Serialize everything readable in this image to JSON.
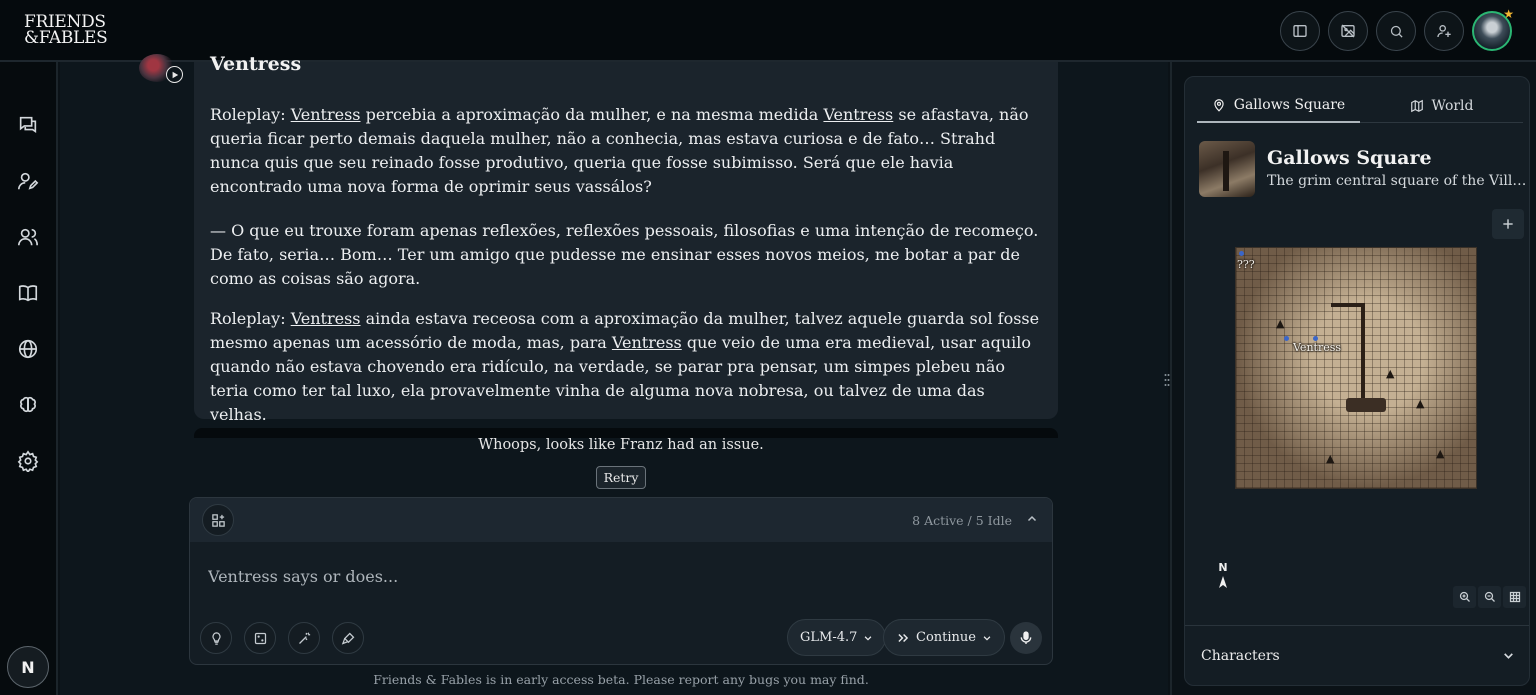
{
  "brand": {
    "line1": "FRIENDS",
    "line2": "&FABLES"
  },
  "topbar": {
    "buttons": [
      "sidebar-toggle-icon",
      "image-off-icon",
      "search-icon",
      "add-user-icon"
    ],
    "avatar_badge": "★"
  },
  "leftnav": {
    "items": [
      "chat-icon",
      "character-edit-icon",
      "party-icon",
      "book-icon",
      "globe-icon",
      "brain-icon",
      "settings-icon"
    ],
    "user_initial": "N"
  },
  "message": {
    "author": "Ventress",
    "paragraphs": [
      [
        {
          "t": "Roleplay: "
        },
        {
          "t": "Ventress",
          "u": true
        },
        {
          "t": " percebia a aproximação da mulher, e na mesma medida "
        },
        {
          "t": "Ventress",
          "u": true
        },
        {
          "t": " se afastava, não queria ficar perto demais daquela mulher, não a conhecia, mas estava curiosa e de fato… Strahd nunca quis que seu reinado fosse produtivo, queria que fosse subimisso. Será que ele havia encontrado uma nova forma de oprimir seus vassálos?"
        }
      ],
      [
        {
          "t": "— O que eu trouxe foram apenas reflexões, reflexões pessoais, filosofias e uma intenção de recomeço. De fato, seria… Bom… Ter um amigo que pudesse me ensinar esses novos meios, me botar a par de como as coisas são agora."
        }
      ],
      [
        {
          "t": "Roleplay: "
        },
        {
          "t": "Ventress",
          "u": true
        },
        {
          "t": " ainda estava receosa com a aproximação da mulher, talvez aquele guarda sol fosse mesmo apenas um acessório de moda, mas, para "
        },
        {
          "t": "Ventress",
          "u": true
        },
        {
          "t": " que veio de uma era medieval, usar aquilo quando não estava chovendo era ridículo, na verdade, se parar pra pensar, um simpes plebeu não teria como ter tal luxo, ela provavelmente vinha de alguma nova nobresa, ou talvez de uma das velhas."
        }
      ]
    ]
  },
  "error": {
    "text": "Whoops, looks like Franz had an issue.",
    "retry_label": "Retry"
  },
  "composer": {
    "status": "8 Active / 5 Idle",
    "placeholder": "Ventress says or does...",
    "model": "GLM-4.7",
    "continue_label": "Continue"
  },
  "footer": "Friends & Fables is in early access beta. Please report any bugs you may find.",
  "panel": {
    "tabs": [
      {
        "label": "Gallows Square",
        "icon": "map-pin-icon",
        "active": true
      },
      {
        "label": "World",
        "icon": "map-icon",
        "active": false
      }
    ],
    "location_title": "Gallows Square",
    "location_desc": "The grim central square of the Village of Barovia.",
    "map_labels": {
      "unknown": "???",
      "character": "Ventress"
    },
    "compass": "N",
    "characters_label": "Characters"
  }
}
